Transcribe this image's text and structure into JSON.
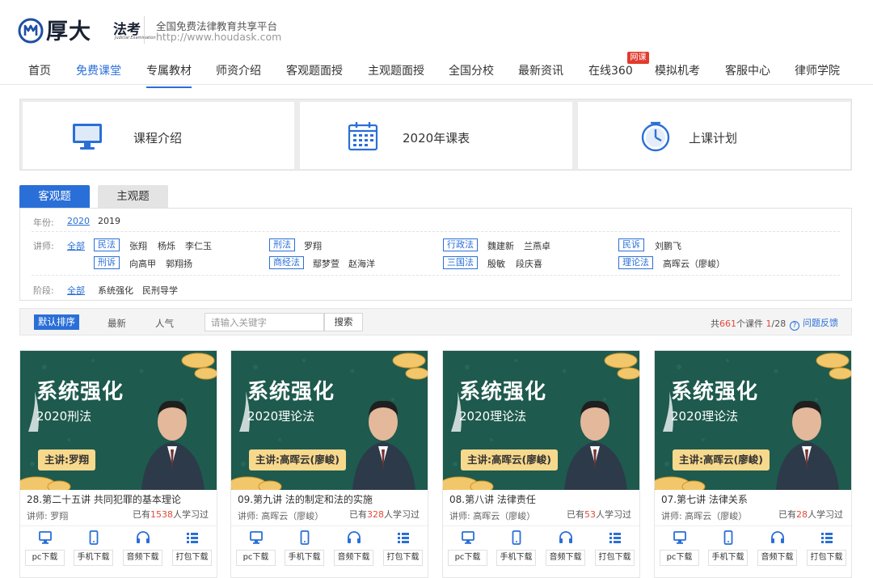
{
  "header": {
    "logo_name": "厚大",
    "logo_sub": "法考",
    "logo_sub_small": "Judicial Examination",
    "slogan": "全国免费法律教育共享平台",
    "url": "http://www.houdask.com"
  },
  "nav": {
    "items": [
      {
        "label": "首页"
      },
      {
        "label": "免费课堂"
      },
      {
        "label": "专属教材"
      },
      {
        "label": "师资介绍"
      },
      {
        "label": "客观题面授"
      },
      {
        "label": "主观题面授"
      },
      {
        "label": "全国分校"
      },
      {
        "label": "最新资讯"
      },
      {
        "label": "在线360"
      },
      {
        "label": "模拟机考"
      },
      {
        "label": "客服中心"
      },
      {
        "label": "律师学院"
      }
    ],
    "badge": "网课"
  },
  "features": [
    {
      "label": "课程介绍",
      "icon": "monitor-icon"
    },
    {
      "label": "2020年课表",
      "icon": "calendar-icon"
    },
    {
      "label": "上课计划",
      "icon": "clock-icon"
    }
  ],
  "tabs": {
    "active": "客观题",
    "inactive": "主观题"
  },
  "filter": {
    "year_label": "年份:",
    "years": [
      "2020",
      "2019"
    ],
    "teacher_label": "讲师:",
    "all": "全部",
    "subjects": [
      {
        "tag": "民法",
        "teachers": [
          "张翔",
          "杨烁",
          "李仁玉"
        ]
      },
      {
        "tag": "刑法",
        "teachers": [
          "罗翔"
        ]
      },
      {
        "tag": "行政法",
        "teachers": [
          "魏建新",
          "兰燕卓"
        ]
      },
      {
        "tag": "民诉",
        "teachers": [
          "刘鹏飞"
        ]
      },
      {
        "tag": "刑诉",
        "teachers": [
          "向高甲",
          "郭翔扬"
        ]
      },
      {
        "tag": "商经法",
        "teachers": [
          "鄢梦萱",
          "赵海洋"
        ]
      },
      {
        "tag": "三国法",
        "teachers": [
          "殷敏",
          "段庆喜"
        ]
      },
      {
        "tag": "理论法",
        "teachers": [
          "高晖云（廖峻）"
        ]
      }
    ],
    "stage_label": "阶段:",
    "stages": [
      "全部",
      "系统强化",
      "民刑导学"
    ]
  },
  "sortbar": {
    "default": "默认排序",
    "latest": "最新",
    "popular": "人气",
    "search_placeholder": "请输入关键字",
    "search_button": "搜索",
    "stats_prefix": "共",
    "total": "661",
    "stats_mid": "个课件 ",
    "page_current": "1",
    "page_total": "/28",
    "feedback": "问题反馈"
  },
  "courses": [
    {
      "thumb_title": "系统强化",
      "thumb_subtitle": "2020刑法",
      "thumb_teacher": "主讲:罗翔",
      "title": "28.第二十五讲 共同犯罪的基本理论",
      "teacher": "讲师:  罗翔",
      "learned_prefix": "已有",
      "learned_count": "1538",
      "learned_suffix": "人学习过"
    },
    {
      "thumb_title": "系统强化",
      "thumb_subtitle": "2020理论法",
      "thumb_teacher": "主讲:高晖云(廖峻)",
      "title": "09.第九讲 法的制定和法的实施",
      "teacher": "讲师:  高晖云（廖峻）",
      "learned_prefix": "已有",
      "learned_count": "328",
      "learned_suffix": "人学习过"
    },
    {
      "thumb_title": "系统强化",
      "thumb_subtitle": "2020理论法",
      "thumb_teacher": "主讲:高晖云(廖峻)",
      "title": "08.第八讲 法律责任",
      "teacher": "讲师:  高晖云（廖峻）",
      "learned_prefix": "已有",
      "learned_count": "53",
      "learned_suffix": "人学习过"
    },
    {
      "thumb_title": "系统强化",
      "thumb_subtitle": "2020理论法",
      "thumb_teacher": "主讲:高晖云(廖峻)",
      "title": "07.第七讲 法律关系",
      "teacher": "讲师:  高晖云（廖峻）",
      "learned_prefix": "已有",
      "learned_count": "28",
      "learned_suffix": "人学习过"
    }
  ],
  "downloads": [
    {
      "label": "pc下载",
      "icon": "pc-icon"
    },
    {
      "label": "手机下载",
      "icon": "phone-icon"
    },
    {
      "label": "音频下载",
      "icon": "headphones-icon"
    },
    {
      "label": "打包下载",
      "icon": "package-list-icon"
    }
  ],
  "colors": {
    "accent": "#2a6fd8",
    "badge": "#e23b2e",
    "count": "#e04a3a",
    "thumb_bg": "#1e5a4e",
    "teacher_tag": "#f7d98d"
  }
}
